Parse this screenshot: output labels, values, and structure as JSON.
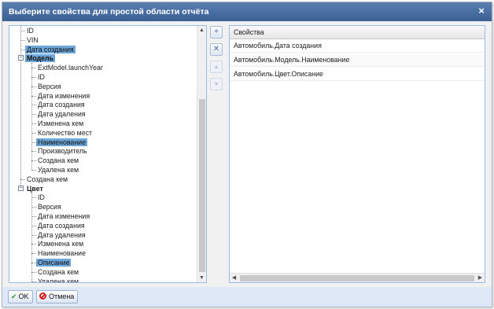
{
  "dialog": {
    "title": "Выберите свойства для простой области отчёта",
    "close_glyph": "×"
  },
  "tree": {
    "items": [
      {
        "label": "ID",
        "selected": false
      },
      {
        "label": "VIN",
        "selected": false
      },
      {
        "label": "Дата создания",
        "selected": true
      },
      {
        "label": "Модель",
        "selected": true,
        "expanded": true
      },
      {
        "label": "ExtModel.launchYear",
        "selected": false
      },
      {
        "label": "ID",
        "selected": false
      },
      {
        "label": "Версия",
        "selected": false
      },
      {
        "label": "Дата изменения",
        "selected": false
      },
      {
        "label": "Дата создания",
        "selected": false
      },
      {
        "label": "Дата удаления",
        "selected": false
      },
      {
        "label": "Изменена кем",
        "selected": false
      },
      {
        "label": "Количество мест",
        "selected": false
      },
      {
        "label": "Наименование",
        "selected": true
      },
      {
        "label": "Производитель",
        "selected": false
      },
      {
        "label": "Создана кем",
        "selected": false
      },
      {
        "label": "Удалена кем",
        "selected": false
      },
      {
        "label": "Создана кем",
        "selected": false
      },
      {
        "label": "Цвет",
        "selected": false,
        "expanded": true
      },
      {
        "label": "ID",
        "selected": false
      },
      {
        "label": "Версия",
        "selected": false
      },
      {
        "label": "Дата изменения",
        "selected": false
      },
      {
        "label": "Дата создания",
        "selected": false
      },
      {
        "label": "Дата удаления",
        "selected": false
      },
      {
        "label": "Изменена кем",
        "selected": false
      },
      {
        "label": "Наименование",
        "selected": false
      },
      {
        "label": "Описание",
        "selected": true
      },
      {
        "label": "Создана кем",
        "selected": false
      },
      {
        "label": "Удалена кем",
        "selected": false
      }
    ],
    "expander_glyph": "−"
  },
  "middle_buttons": {
    "add_icon": "add-icon",
    "remove_icon": "remove-icon",
    "up_icon": "arrow-up-icon",
    "down_icon": "arrow-down-icon",
    "add_glyph": "+",
    "remove_glyph": "✕",
    "up_glyph": "▲",
    "down_glyph": "▼"
  },
  "properties": {
    "column_header": "Свойства",
    "rows": [
      "Автомобиль.Дата создания",
      "Автомобиль.Модель.Наименование",
      "Автомобиль.Цвет.Описание"
    ]
  },
  "footer": {
    "ok_label": "OK",
    "cancel_label": "Отмена",
    "ok_glyph": "✔"
  },
  "scroll_glyphs": {
    "up": "▲",
    "down": "▼",
    "left": "◀",
    "right": "▶"
  },
  "colors": {
    "titlebar": "#3f6499",
    "selection": "#6da6d8",
    "panel_border": "#99bbe8"
  }
}
